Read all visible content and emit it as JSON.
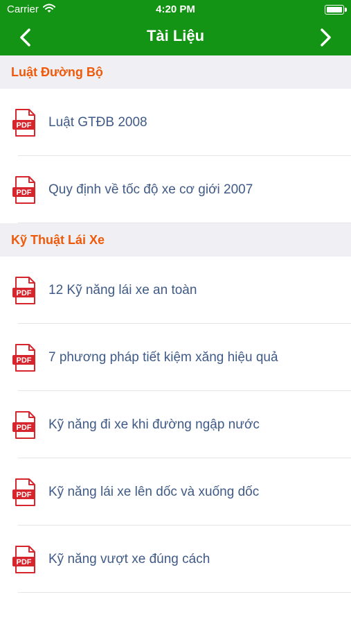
{
  "status_bar": {
    "carrier": "Carrier",
    "time": "4:20 PM",
    "battery_percent": 100
  },
  "nav": {
    "title": "Tài Liệu",
    "back_icon": "chevron-left-icon",
    "forward_icon": "chevron-right-icon"
  },
  "colors": {
    "nav_background": "#149414",
    "section_header_text": "#ef5a0a",
    "section_header_background": "#efeff4",
    "item_text": "#3f5a86",
    "pdf_icon": "#d6252c"
  },
  "pdf_icon_text": "PDF",
  "sections": [
    {
      "title": "Luật Đường Bộ",
      "items": [
        {
          "label": "Luật GTĐB 2008",
          "icon": "pdf-icon"
        },
        {
          "label": "Quy định về tốc độ xe cơ giới 2007",
          "icon": "pdf-icon"
        }
      ]
    },
    {
      "title": "Kỹ Thuật Lái Xe",
      "items": [
        {
          "label": "12 Kỹ năng lái xe an toàn",
          "icon": "pdf-icon"
        },
        {
          "label": "7 phương pháp tiết kiệm xăng hiệu quả",
          "icon": "pdf-icon"
        },
        {
          "label": "Kỹ năng đi xe khi đường ngập nước",
          "icon": "pdf-icon"
        },
        {
          "label": "Kỹ năng lái xe lên dốc và xuống dốc",
          "icon": "pdf-icon"
        },
        {
          "label": "Kỹ năng vượt xe đúng cách",
          "icon": "pdf-icon"
        }
      ]
    }
  ]
}
